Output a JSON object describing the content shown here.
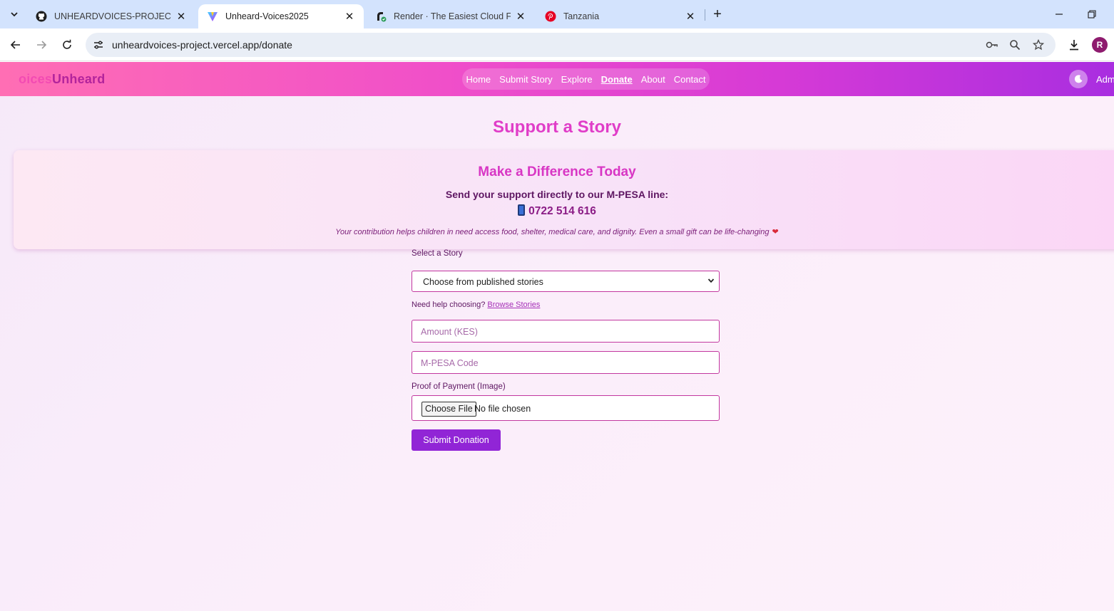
{
  "browser": {
    "tabs": [
      {
        "title": "UNHEARDVOICES-PROJECT/ at",
        "favicon": "github-icon",
        "active": false
      },
      {
        "title": "Unheard-Voices2025",
        "favicon": "vercel-icon",
        "active": true
      },
      {
        "title": "Render · The Easiest Cloud For A",
        "favicon": "render-icon",
        "active": false
      },
      {
        "title": "Tanzania",
        "favicon": "pinterest-icon",
        "active": false
      }
    ],
    "url": "unheardvoices-project.vercel.app/donate",
    "profile_initial": "R"
  },
  "site": {
    "logo_part1": "oices",
    "logo_part2": "Unheard",
    "nav": [
      "Home",
      "Submit Story",
      "Explore",
      "Donate",
      "About",
      "Contact"
    ],
    "current_nav": "Donate",
    "admin_label": "Adm"
  },
  "donate": {
    "page_title": "Support a Story",
    "card": {
      "title": "Make a Difference Today",
      "line": "Send your support directly to our M-PESA line:",
      "phone": "0722 514 616",
      "note": "Your contribution helps children in need access food, shelter, medical care, and dignity. Even a small gift can be life-changing"
    },
    "form": {
      "story_label": "Select a Story",
      "story_selected": "Choose from published stories",
      "help_text": "Need help choosing?",
      "help_link": "Browse Stories",
      "amount_placeholder": "Amount (KES)",
      "mpesa_placeholder": "M-PESA Code",
      "proof_label": "Proof of Payment (Image)",
      "file_button": "Choose File",
      "file_status": "No file chosen",
      "submit_label": "Submit Donation"
    }
  }
}
